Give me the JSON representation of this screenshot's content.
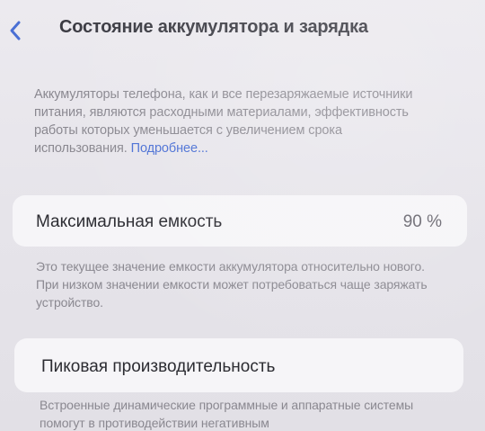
{
  "nav": {
    "back_icon": "chevron-left-icon",
    "title": "Состояние аккумулятора и зарядка"
  },
  "intro": {
    "text": "Аккумуляторы телефона, как и все перезаряжаемые источники питания, являются расходными материалами, эффективность работы которых уменьшается с увеличением срока использования. ",
    "link": "Подробнее..."
  },
  "capacity": {
    "label": "Максимальная емкость",
    "value": "90 %",
    "note": "Это текущее значение емкости аккумулятора относительно нового. При низком значении емкости может потребоваться чаще заряжать устройство."
  },
  "peak": {
    "label": "Пиковая производительность",
    "note": "Встроенные динамические программные и аппаратные системы помогут в противодействии негативным"
  },
  "colors": {
    "accent": "#4a6fd4",
    "background": "#e9e7ec",
    "card": "#f6f5f8"
  }
}
